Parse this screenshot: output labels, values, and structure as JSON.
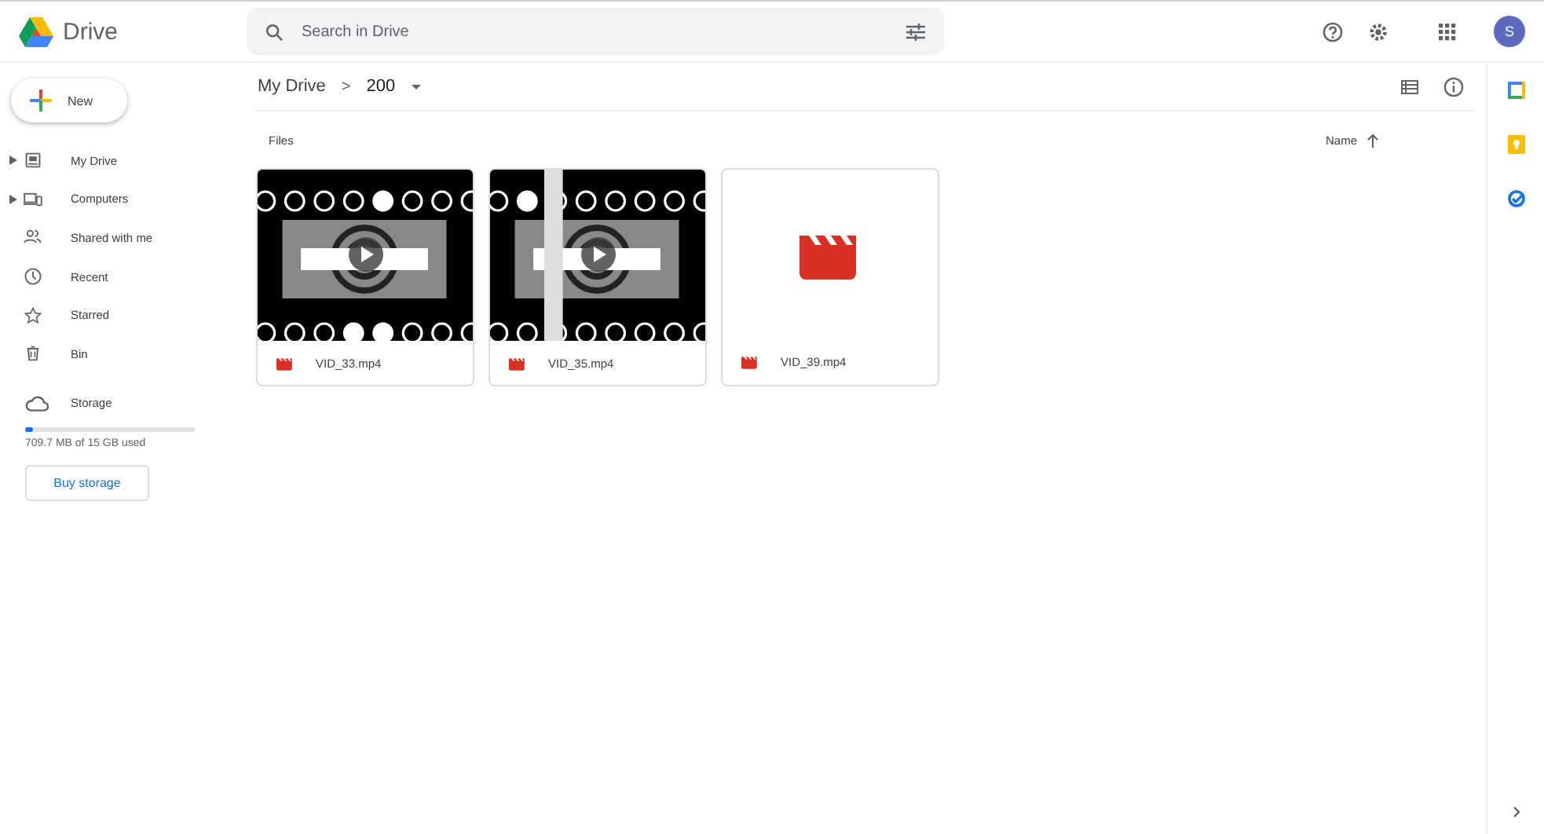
{
  "app": {
    "name": "Drive"
  },
  "search": {
    "placeholder": "Search in Drive"
  },
  "account": {
    "initial": "S"
  },
  "new_button": {
    "label": "New"
  },
  "sidebar": {
    "items": [
      {
        "label": "My Drive",
        "expandable": true,
        "selected": false
      },
      {
        "label": "Computers",
        "expandable": true,
        "selected": false
      },
      {
        "label": "Shared with me",
        "expandable": false,
        "selected": false
      },
      {
        "label": "Recent",
        "expandable": false,
        "selected": false
      },
      {
        "label": "Starred",
        "expandable": false,
        "selected": false
      },
      {
        "label": "Bin",
        "expandable": false,
        "selected": false
      }
    ]
  },
  "storage": {
    "label": "Storage",
    "level": 0.05,
    "usage": "709.7 MB of 15 GB used",
    "button": "Buy storage"
  },
  "breadcrumb": {
    "parent": "My Drive",
    "separator": ">",
    "current": "200"
  },
  "section": {
    "title": "Files",
    "sort": "Name"
  },
  "files": [
    {
      "name": "VID_33.mp4",
      "kind": "thumbnail"
    },
    {
      "name": "VID_35.mp4",
      "kind": "thumbnail"
    },
    {
      "name": "VID_39.mp4",
      "kind": "placeholder"
    }
  ]
}
